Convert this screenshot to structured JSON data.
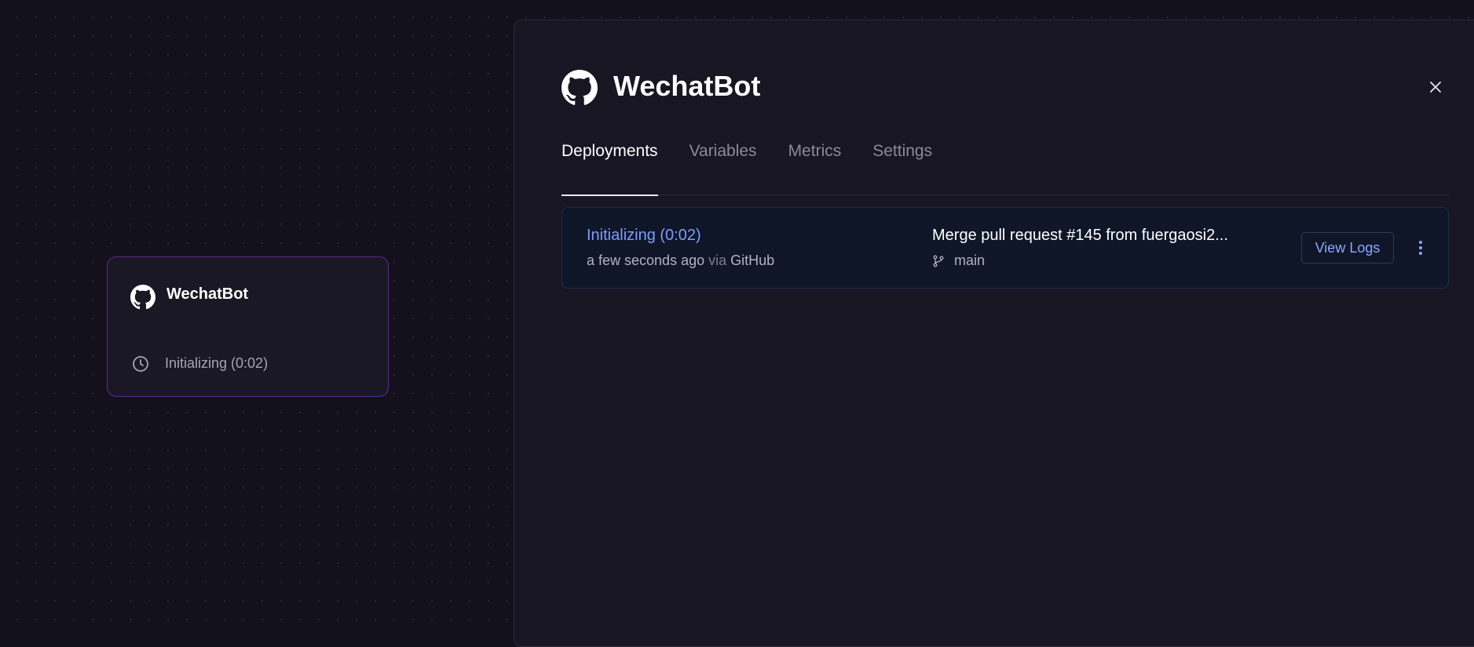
{
  "service_card": {
    "title": "WechatBot",
    "status": "Initializing (0:02)",
    "icon": "github-icon"
  },
  "panel": {
    "title": "WechatBot",
    "icon": "github-icon",
    "tabs": [
      {
        "label": "Deployments",
        "active": true
      },
      {
        "label": "Variables",
        "active": false
      },
      {
        "label": "Metrics",
        "active": false
      },
      {
        "label": "Settings",
        "active": false
      }
    ],
    "deployment": {
      "status": "Initializing (0:02)",
      "time": "a few seconds ago",
      "via_word": "via",
      "source": "GitHub",
      "commit_message": "Merge pull request #145 from fuergaosi2...",
      "branch": "main",
      "view_logs_label": "View Logs"
    }
  },
  "colors": {
    "background": "#13111c",
    "card_border": "#5b2d8e",
    "status_link": "#7f9cff",
    "deploy_row_bg": "#0f1628"
  }
}
